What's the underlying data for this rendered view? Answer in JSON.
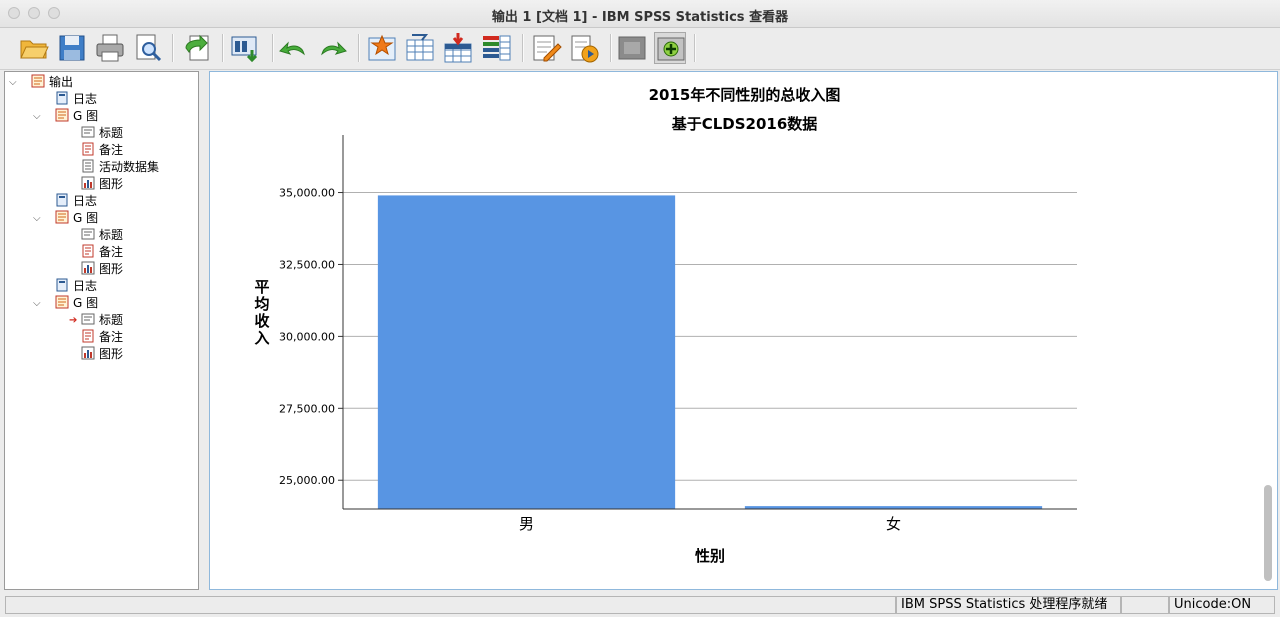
{
  "window": {
    "title": "输出 1 [文档 1] - IBM SPSS Statistics 查看器"
  },
  "toolbar": {
    "buttons": [
      "open-icon",
      "save-icon",
      "print-icon",
      "print-preview-icon",
      "export-icon",
      "recall-dialog-icon",
      "undo-icon",
      "redo-icon",
      "goto-case-icon",
      "goto-variable-icon",
      "insert-cases-icon",
      "variables-icon",
      "edit-icon",
      "run-icon",
      "hide-icon",
      "show-icon"
    ]
  },
  "tree": {
    "root": "输出",
    "items": [
      "日志",
      "G 图",
      "标题",
      "备注",
      "活动数据集",
      "图形",
      "日志",
      "G 图",
      "标题",
      "备注",
      "图形",
      "日志",
      "G 图",
      "标题",
      "备注",
      "图形"
    ]
  },
  "chart_data": {
    "type": "bar",
    "title": "2015年不同性别的总收入图",
    "subtitle": "基于CLDS2016数据",
    "xlabel": "性别",
    "ylabel": "平均收入",
    "categories": [
      "男",
      "女"
    ],
    "values": [
      34900,
      24100
    ],
    "ylim": [
      24000,
      37000
    ],
    "yticks": [
      25000,
      27500,
      30000,
      32500,
      35000
    ],
    "ytick_labels": [
      "25,000.00",
      "27,500.00",
      "30,000.00",
      "32,500.00",
      "35,000.00"
    ],
    "grid": true,
    "bar_color": "#5895e3"
  },
  "status": {
    "processor": "IBM SPSS Statistics 处理程序就绪",
    "unicode": "Unicode:ON"
  }
}
